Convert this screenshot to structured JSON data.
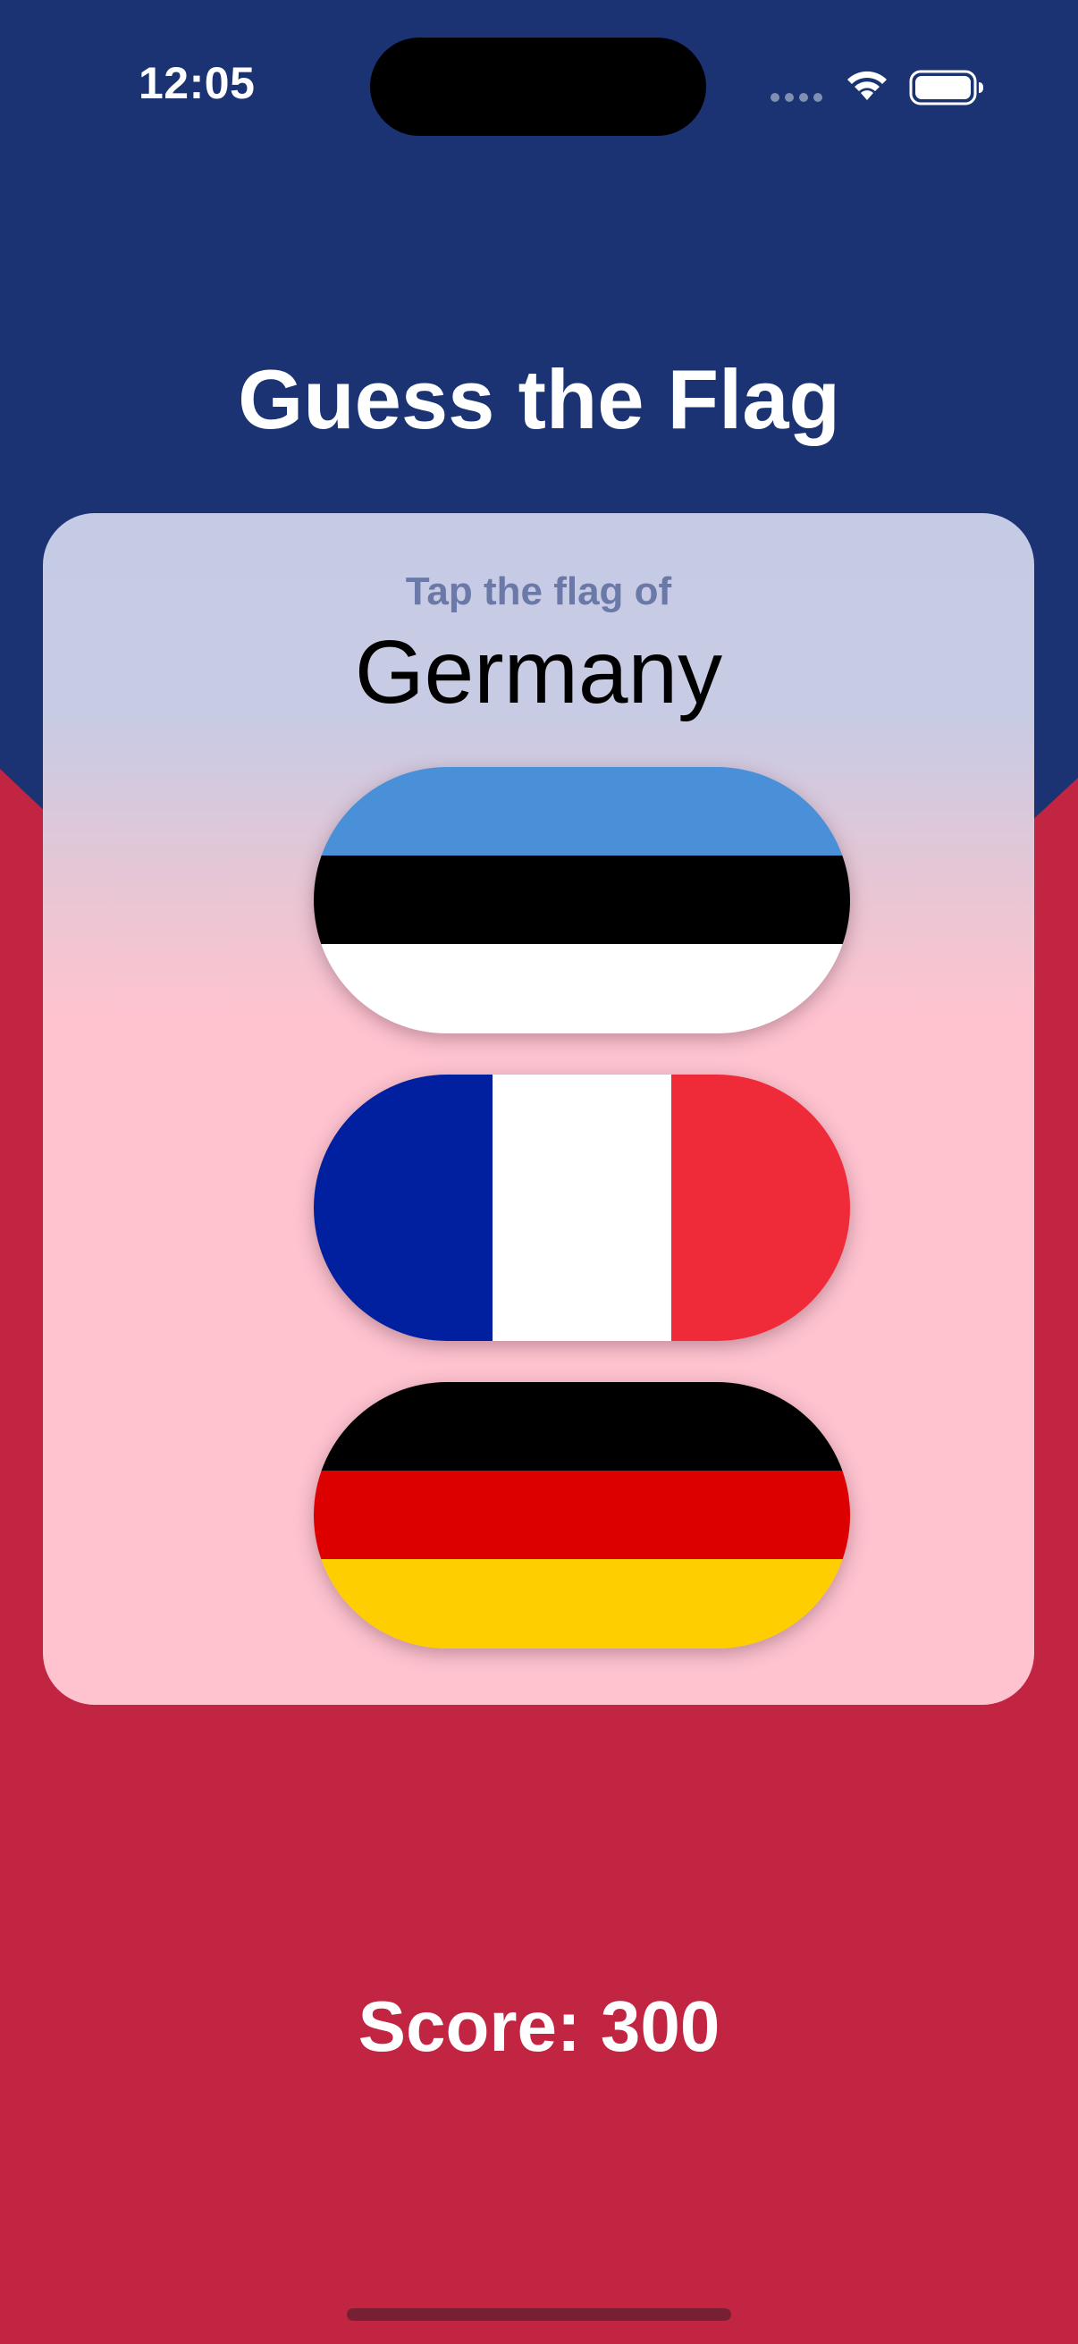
{
  "status_bar": {
    "time": "12:05",
    "wifi_icon": "wifi-icon",
    "battery_icon": "battery-icon"
  },
  "title": "Guess the Flag",
  "card": {
    "prompt": "Tap the flag of",
    "country": "Germany"
  },
  "flags": [
    {
      "name": "estonia-flag",
      "colors": [
        "#4a90d9",
        "#000000",
        "#ffffff"
      ],
      "orientation": "horizontal"
    },
    {
      "name": "france-flag",
      "colors": [
        "#00209f",
        "#ffffff",
        "#ef2b3a"
      ],
      "orientation": "vertical"
    },
    {
      "name": "germany-flag",
      "colors": [
        "#000000",
        "#dd0000",
        "#ffce00"
      ],
      "orientation": "horizontal"
    }
  ],
  "score": "Score: 300",
  "colors": {
    "background_top": "#1b3373",
    "background_bottom": "#c22542",
    "card_top": "#c6cbe5",
    "card_bottom": "#fec3cf",
    "prompt_text": "#6b79a8"
  }
}
